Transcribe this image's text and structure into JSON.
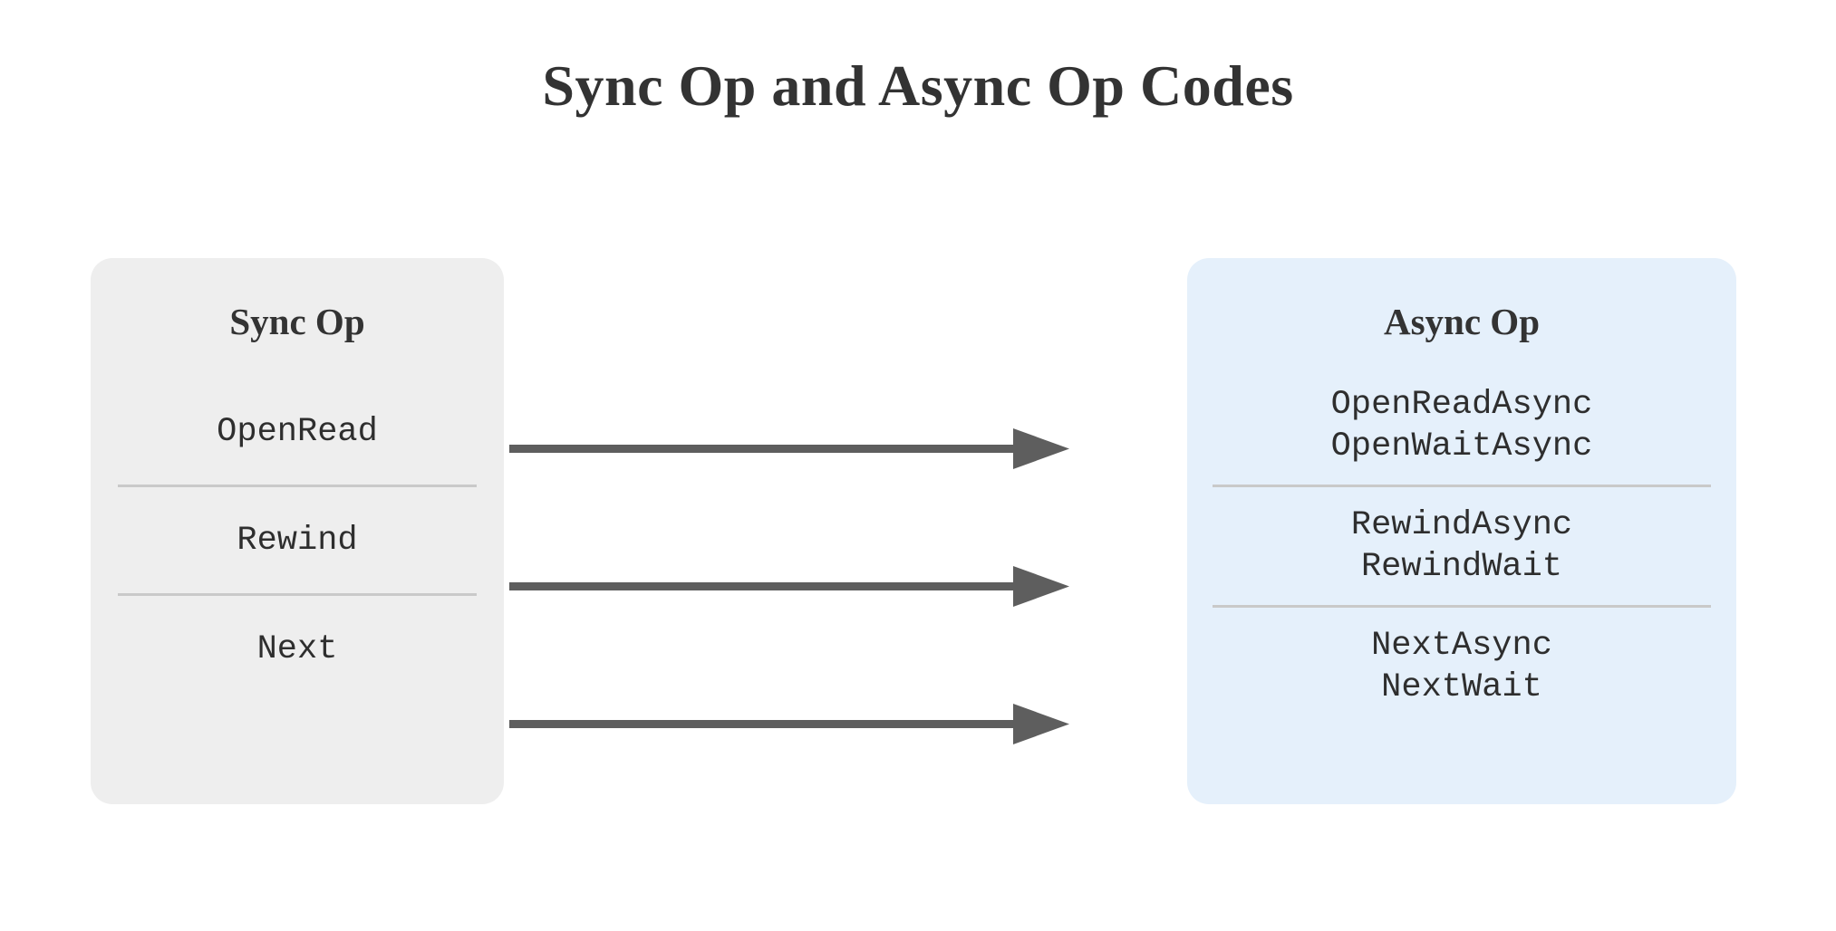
{
  "title": "Sync Op and Async Op Codes",
  "colors": {
    "background": "#ffffff",
    "title_text": "#333333",
    "sync_panel_bg": "#eeeeee",
    "async_panel_bg": "#e5f0fb",
    "op_text": "#2e2e2e",
    "divider": "#c9c9c9",
    "arrow": "#5e5e5e"
  },
  "sync_panel": {
    "header": "Sync Op",
    "groups": [
      {
        "ops": [
          "OpenRead"
        ]
      },
      {
        "ops": [
          "Rewind"
        ]
      },
      {
        "ops": [
          "Next"
        ]
      }
    ]
  },
  "async_panel": {
    "header": "Async Op",
    "groups": [
      {
        "ops": [
          "OpenReadAsync",
          "OpenWaitAsync"
        ]
      },
      {
        "ops": [
          "RewindAsync",
          "RewindWait"
        ]
      },
      {
        "ops": [
          "NextAsync",
          "NextWait"
        ]
      }
    ]
  },
  "arrows": [
    {
      "from": "OpenRead",
      "to": "OpenReadAsync"
    },
    {
      "from": "Rewind",
      "to": "RewindAsync"
    },
    {
      "from": "Next",
      "to": "NextAsync"
    }
  ]
}
